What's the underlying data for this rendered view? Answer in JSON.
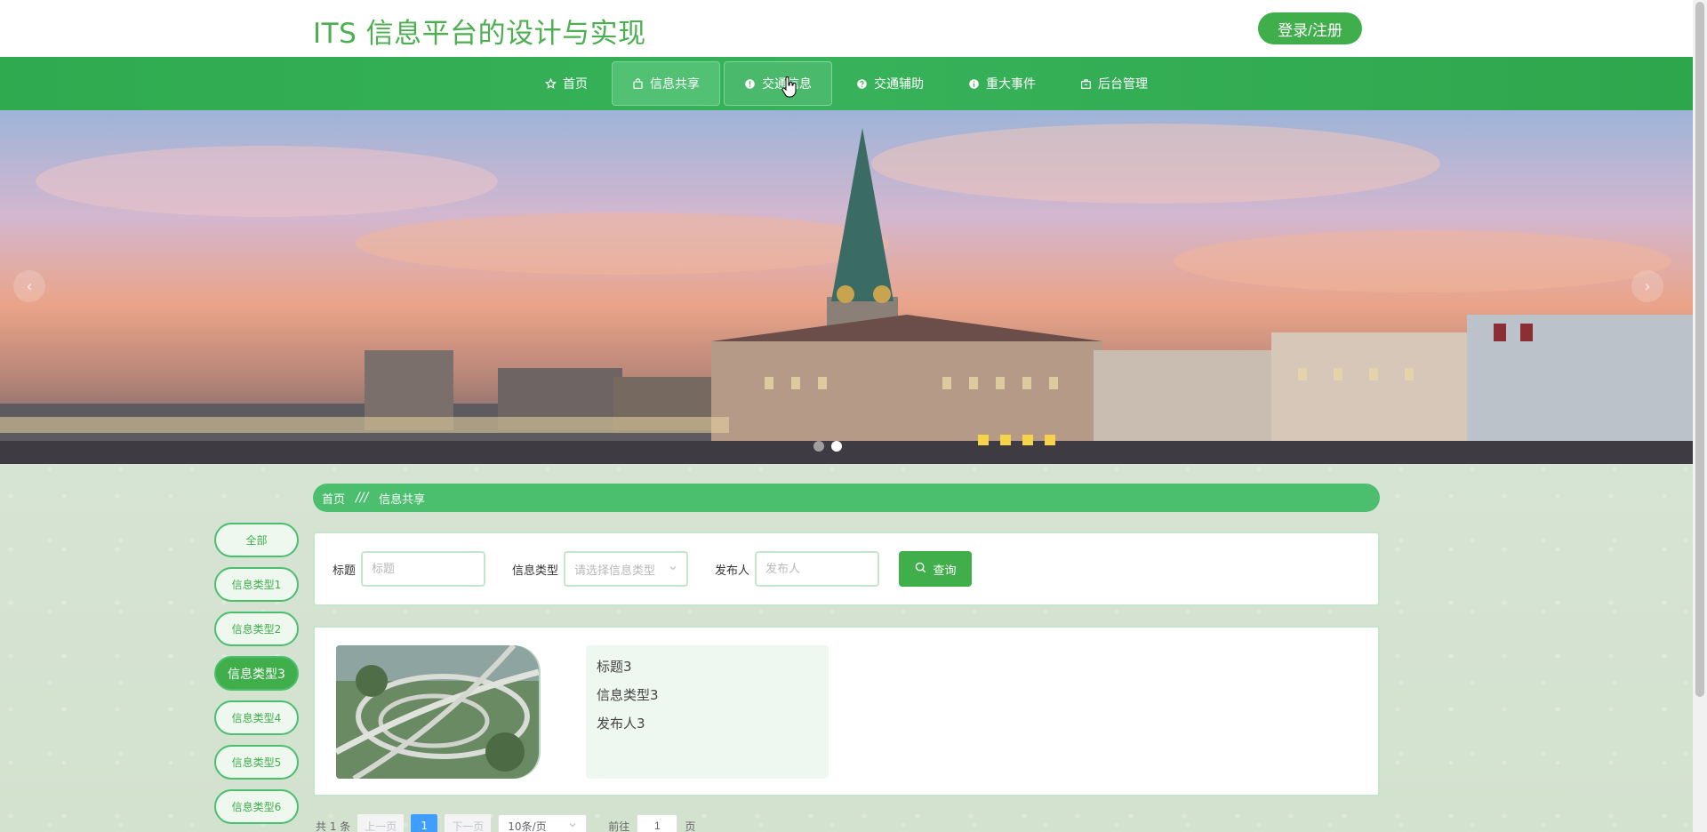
{
  "header": {
    "site_title": "ITS 信息平台的设计与实现",
    "login_label": "登录/注册"
  },
  "nav": {
    "items": [
      {
        "label": "首页",
        "icon": "star-icon"
      },
      {
        "label": "信息共享",
        "icon": "bag-icon"
      },
      {
        "label": "交通信息",
        "icon": "alert-circle-icon"
      },
      {
        "label": "交通辅助",
        "icon": "question-circle-icon"
      },
      {
        "label": "重大事件",
        "icon": "info-circle-icon"
      },
      {
        "label": "后台管理",
        "icon": "briefcase-icon"
      }
    ],
    "active_index": 1,
    "hover_index": 2
  },
  "banner": {
    "prev_symbol": "‹",
    "next_symbol": "›",
    "slide_count": 2,
    "active_slide": 1
  },
  "breadcrumb": {
    "home": "首页",
    "separator": "///",
    "current": "信息共享"
  },
  "categories": {
    "items": [
      "全部",
      "信息类型1",
      "信息类型2",
      "信息类型3",
      "信息类型4",
      "信息类型5",
      "信息类型6"
    ],
    "active_index": 3
  },
  "search": {
    "title_label": "标题",
    "title_placeholder": "标题",
    "type_label": "信息类型",
    "type_placeholder": "请选择信息类型",
    "publisher_label": "发布人",
    "publisher_placeholder": "发布人",
    "query_label": "查询"
  },
  "results": [
    {
      "title": "标题3",
      "type": "信息类型3",
      "publisher": "发布人3"
    }
  ],
  "pagination": {
    "total": "共 1 条",
    "prev": "上一页",
    "current_page": "1",
    "next": "下一页",
    "page_size": "10条/页",
    "goto_prefix": "前往",
    "goto_value": "1",
    "goto_suffix": "页"
  },
  "colors": {
    "brand_green": "#3fae4b",
    "nav_green": "#2faa4f",
    "accent_blue": "#409eff"
  }
}
